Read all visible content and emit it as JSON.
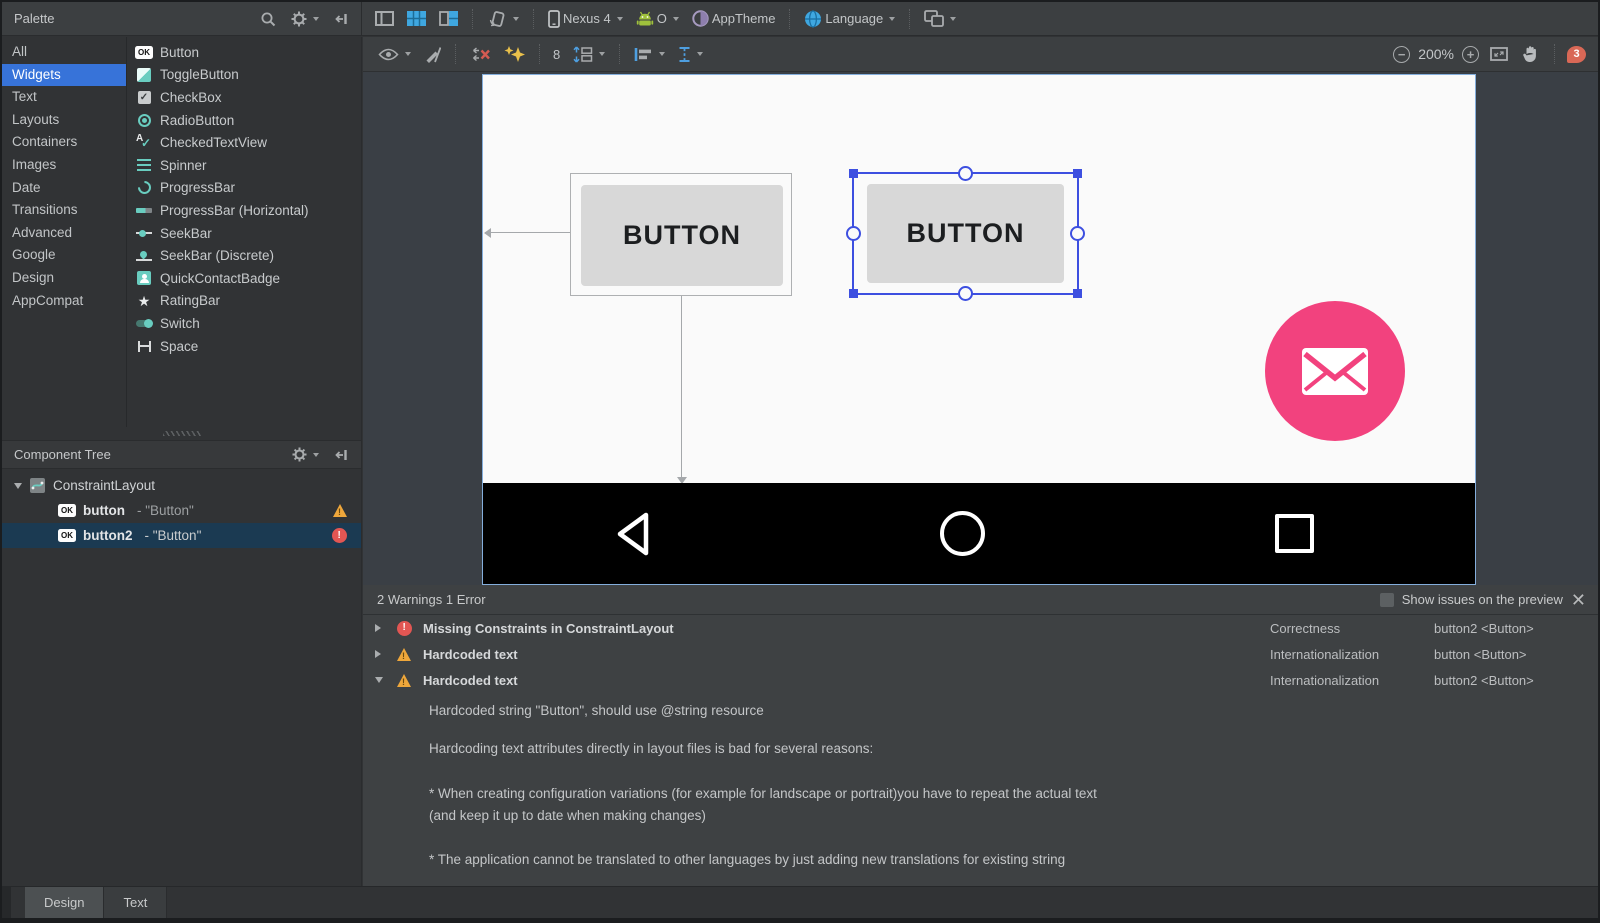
{
  "colors": {
    "accent_blue": "#3773d9",
    "selection_blue": "#3d4fe0",
    "teal_icon": "#69cdc0",
    "fab_pink": "#f2427e",
    "warning": "#efa73b",
    "error": "#e25653",
    "blueprint_blue": "#3fa7e0",
    "panel_bg": "#3c3f41"
  },
  "icons": {
    "ok": "OK",
    "star": "★",
    "check": "✓",
    "letter_a": "A",
    "close": "✕",
    "minus": "−",
    "plus": "+"
  },
  "palette": {
    "title": "Palette",
    "categories": [
      "All",
      "Widgets",
      "Text",
      "Layouts",
      "Containers",
      "Images",
      "Date",
      "Transitions",
      "Advanced",
      "Google",
      "Design",
      "AppCompat"
    ],
    "selected_category": "Widgets",
    "widgets": [
      {
        "label": "Button"
      },
      {
        "label": "ToggleButton"
      },
      {
        "label": "CheckBox"
      },
      {
        "label": "RadioButton"
      },
      {
        "label": "CheckedTextView"
      },
      {
        "label": "Spinner"
      },
      {
        "label": "ProgressBar"
      },
      {
        "label": "ProgressBar (Horizontal)"
      },
      {
        "label": "SeekBar"
      },
      {
        "label": "SeekBar (Discrete)"
      },
      {
        "label": "QuickContactBadge"
      },
      {
        "label": "RatingBar"
      },
      {
        "label": "Switch"
      },
      {
        "label": "Space"
      }
    ]
  },
  "main_toolbar": {
    "device": "Nexus 4",
    "api_level": "O",
    "theme": "AppTheme",
    "language": "Language"
  },
  "design_toolbar": {
    "default_margin": "8",
    "zoom_level": "200%",
    "error_count": "3"
  },
  "component_tree": {
    "title": "Component Tree",
    "items": [
      {
        "label": "ConstraintLayout"
      },
      {
        "name": "button",
        "value": "- \"Button\"",
        "status": "warning"
      },
      {
        "name": "button2",
        "value": "- \"Button\"",
        "status": "error",
        "selected": true
      }
    ]
  },
  "canvas": {
    "button1_label": "BUTTON",
    "button2_label": "BUTTON"
  },
  "issues": {
    "summary": "2 Warnings 1 Error",
    "show_on_preview_label": "Show issues on the preview",
    "rows": [
      {
        "severity": "error",
        "title": "Missing Constraints in ConstraintLayout",
        "category": "Correctness",
        "source": "button2 <Button>"
      },
      {
        "severity": "warning",
        "title": "Hardcoded text",
        "category": "Internationalization",
        "source": "button <Button>"
      },
      {
        "severity": "warning",
        "title": "Hardcoded text",
        "category": "Internationalization",
        "source": "button2 <Button>"
      }
    ],
    "detail_lines": [
      "Hardcoded string \"Button\", should use @string resource",
      "Hardcoding text attributes directly in layout files is bad for several reasons:",
      "* When creating configuration variations (for example for landscape or portrait)you have to repeat the actual text",
      "(and keep it up to date when making changes)",
      "* The application cannot be translated to other languages by just adding new translations for existing string"
    ]
  },
  "tabs": [
    {
      "label": "Design"
    },
    {
      "label": "Text"
    }
  ]
}
